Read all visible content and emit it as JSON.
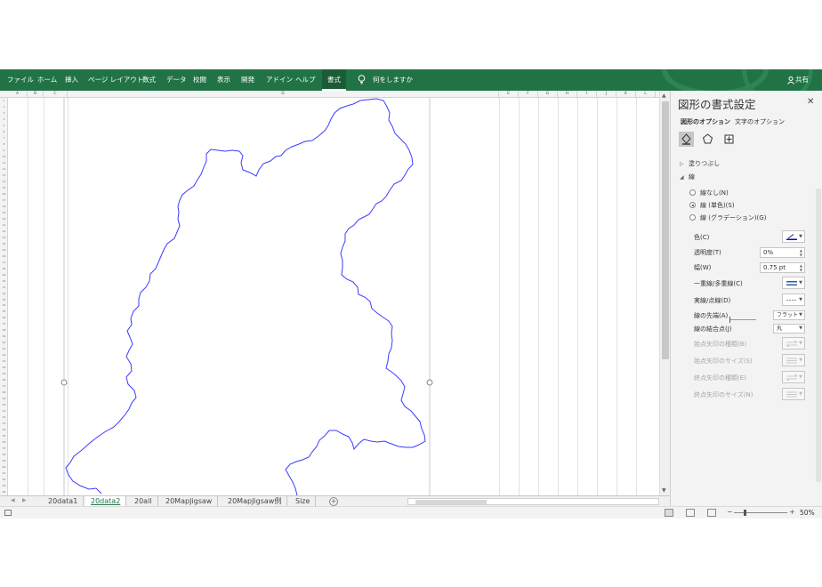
{
  "ribbon": {
    "tabs": [
      "ファイル",
      "ホーム",
      "挿入",
      "ページ レイアウト",
      "数式",
      "データ",
      "校閲",
      "表示",
      "開発",
      "アドイン",
      "ヘルプ"
    ],
    "active_tab": "書式",
    "tell_me": "何をしますか",
    "share": "共有",
    "color": "#217346"
  },
  "grid": {
    "column_headers": [
      "A",
      "B",
      "C",
      "D",
      "E",
      "F",
      "G",
      "H",
      "I",
      "J",
      "K",
      "L"
    ],
    "row_count": 64
  },
  "sheet_tabs": [
    "20data1",
    "20data2",
    "20all",
    "20MapJigsaw",
    "20MapJigsaw例",
    "Size"
  ],
  "active_sheet": "20data2",
  "status_bar": {
    "zoom_minus": "−",
    "zoom_plus": "+",
    "zoom_level": "50%"
  },
  "format_pane": {
    "title": "図形の書式設定",
    "tabs": [
      "図形のオプション",
      "文字のオプション"
    ],
    "active_tab": "図形のオプション",
    "fill_section": "塗りつぶし",
    "line_section": "線",
    "line_options": [
      {
        "label": "線なし(N)",
        "selected": false
      },
      {
        "label": "線 (単色)(S)",
        "selected": true
      },
      {
        "label": "線 (グラデーション)(G)",
        "selected": false
      }
    ],
    "properties": {
      "color_label": "色(C)",
      "transparency_label": "透明度(T)",
      "transparency_value": "0%",
      "width_label": "幅(W)",
      "width_value": "0.75 pt",
      "compound_label": "一重線/多重線(C)",
      "dash_label": "実線/点線(D)",
      "cap_label": "線の先端(A)",
      "cap_value": "フラット",
      "join_label": "線の結合点(J)",
      "join_value": "丸",
      "begin_arrow_type": "始点矢印の種類(B)",
      "begin_arrow_size": "始点矢印のサイズ(S)",
      "end_arrow_type": "終点矢印の種類(E)",
      "end_arrow_size": "終点矢印のサイズ(N)"
    },
    "line_color": "#0000ff"
  },
  "shape": {
    "outline_color": "#3b3bff"
  }
}
